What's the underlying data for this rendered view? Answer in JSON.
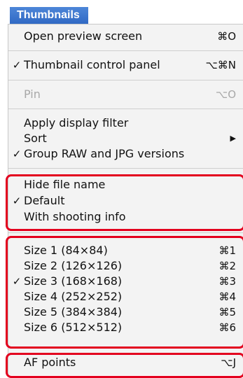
{
  "menu": {
    "title": "Thumbnails",
    "items": [
      {
        "label": "Open preview screen",
        "shortcut": "⌘O",
        "check": "",
        "disabled": false
      },
      {
        "label": "Thumbnail control panel",
        "shortcut": "⌥⌘N",
        "check": "✓",
        "disabled": false
      },
      {
        "label": "Pin",
        "shortcut": "⌥O",
        "check": "",
        "disabled": true
      },
      {
        "label": "Apply display filter",
        "shortcut": "",
        "check": "",
        "disabled": false
      },
      {
        "label": "Sort",
        "shortcut": "",
        "check": "",
        "submenu": true,
        "disabled": false
      },
      {
        "label": "Group RAW and JPG versions",
        "shortcut": "",
        "check": "✓",
        "disabled": false
      },
      {
        "label": "Hide file name",
        "shortcut": "",
        "check": "",
        "disabled": false
      },
      {
        "label": "Default",
        "shortcut": "",
        "check": "✓",
        "disabled": false
      },
      {
        "label": "With shooting info",
        "shortcut": "",
        "check": "",
        "disabled": false
      },
      {
        "label": "Size 1 (84×84)",
        "shortcut": "⌘1",
        "check": "",
        "disabled": false
      },
      {
        "label": "Size 2 (126×126)",
        "shortcut": "⌘2",
        "check": "",
        "disabled": false
      },
      {
        "label": "Size 3 (168×168)",
        "shortcut": "⌘3",
        "check": "✓",
        "disabled": false
      },
      {
        "label": "Size 4 (252×252)",
        "shortcut": "⌘4",
        "check": "",
        "disabled": false
      },
      {
        "label": "Size 5 (384×384)",
        "shortcut": "⌘5",
        "check": "",
        "disabled": false
      },
      {
        "label": "Size 6 (512×512)",
        "shortcut": "⌘6",
        "check": "",
        "disabled": false
      },
      {
        "label": "AF points",
        "shortcut": "⌥J",
        "check": "",
        "disabled": false
      }
    ],
    "submenu_arrow": "▶",
    "highlight_color": "#e3001e"
  }
}
